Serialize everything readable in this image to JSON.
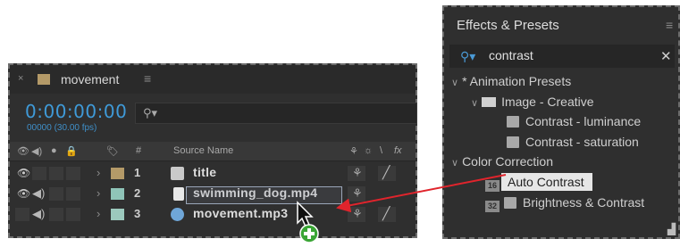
{
  "timeline": {
    "tab_close": "×",
    "tab_name": "movement",
    "tab_menu": "≡",
    "timecode": "0:00:00:00",
    "fps": "00000 (30.00 fps)",
    "search_placeholder": "",
    "columns": {
      "label_hash": "#",
      "source_name": "Source Name"
    },
    "layers": [
      {
        "number": "1",
        "name": "title",
        "label_color": "#b49a68",
        "icon": "composition-icon"
      },
      {
        "number": "2",
        "name": "swimming_dog.mp4",
        "label_color": "#8fc4b8",
        "icon": "video-file-icon"
      },
      {
        "number": "3",
        "name": "movement.mp3",
        "label_color": "#9cc9bd",
        "icon": "audio-file-icon"
      }
    ]
  },
  "effects": {
    "title": "Effects & Presets",
    "menu": "≡",
    "search_value": "contrast",
    "clear": "✕",
    "tree": {
      "animation_presets": "* Animation Presets",
      "image_creative": "Image - Creative",
      "preset_1": "Contrast - luminance",
      "preset_2": "Contrast - saturation",
      "color_correction": "Color Correction",
      "effect_1": "Auto Contrast",
      "effect_2": "Brightness & Contrast",
      "badge_16": "16",
      "badge_32": "32"
    }
  },
  "colors": {
    "arrow": "#e0242c",
    "plus_badge": "#3aa535",
    "accent_blue": "#3f9ad8"
  }
}
